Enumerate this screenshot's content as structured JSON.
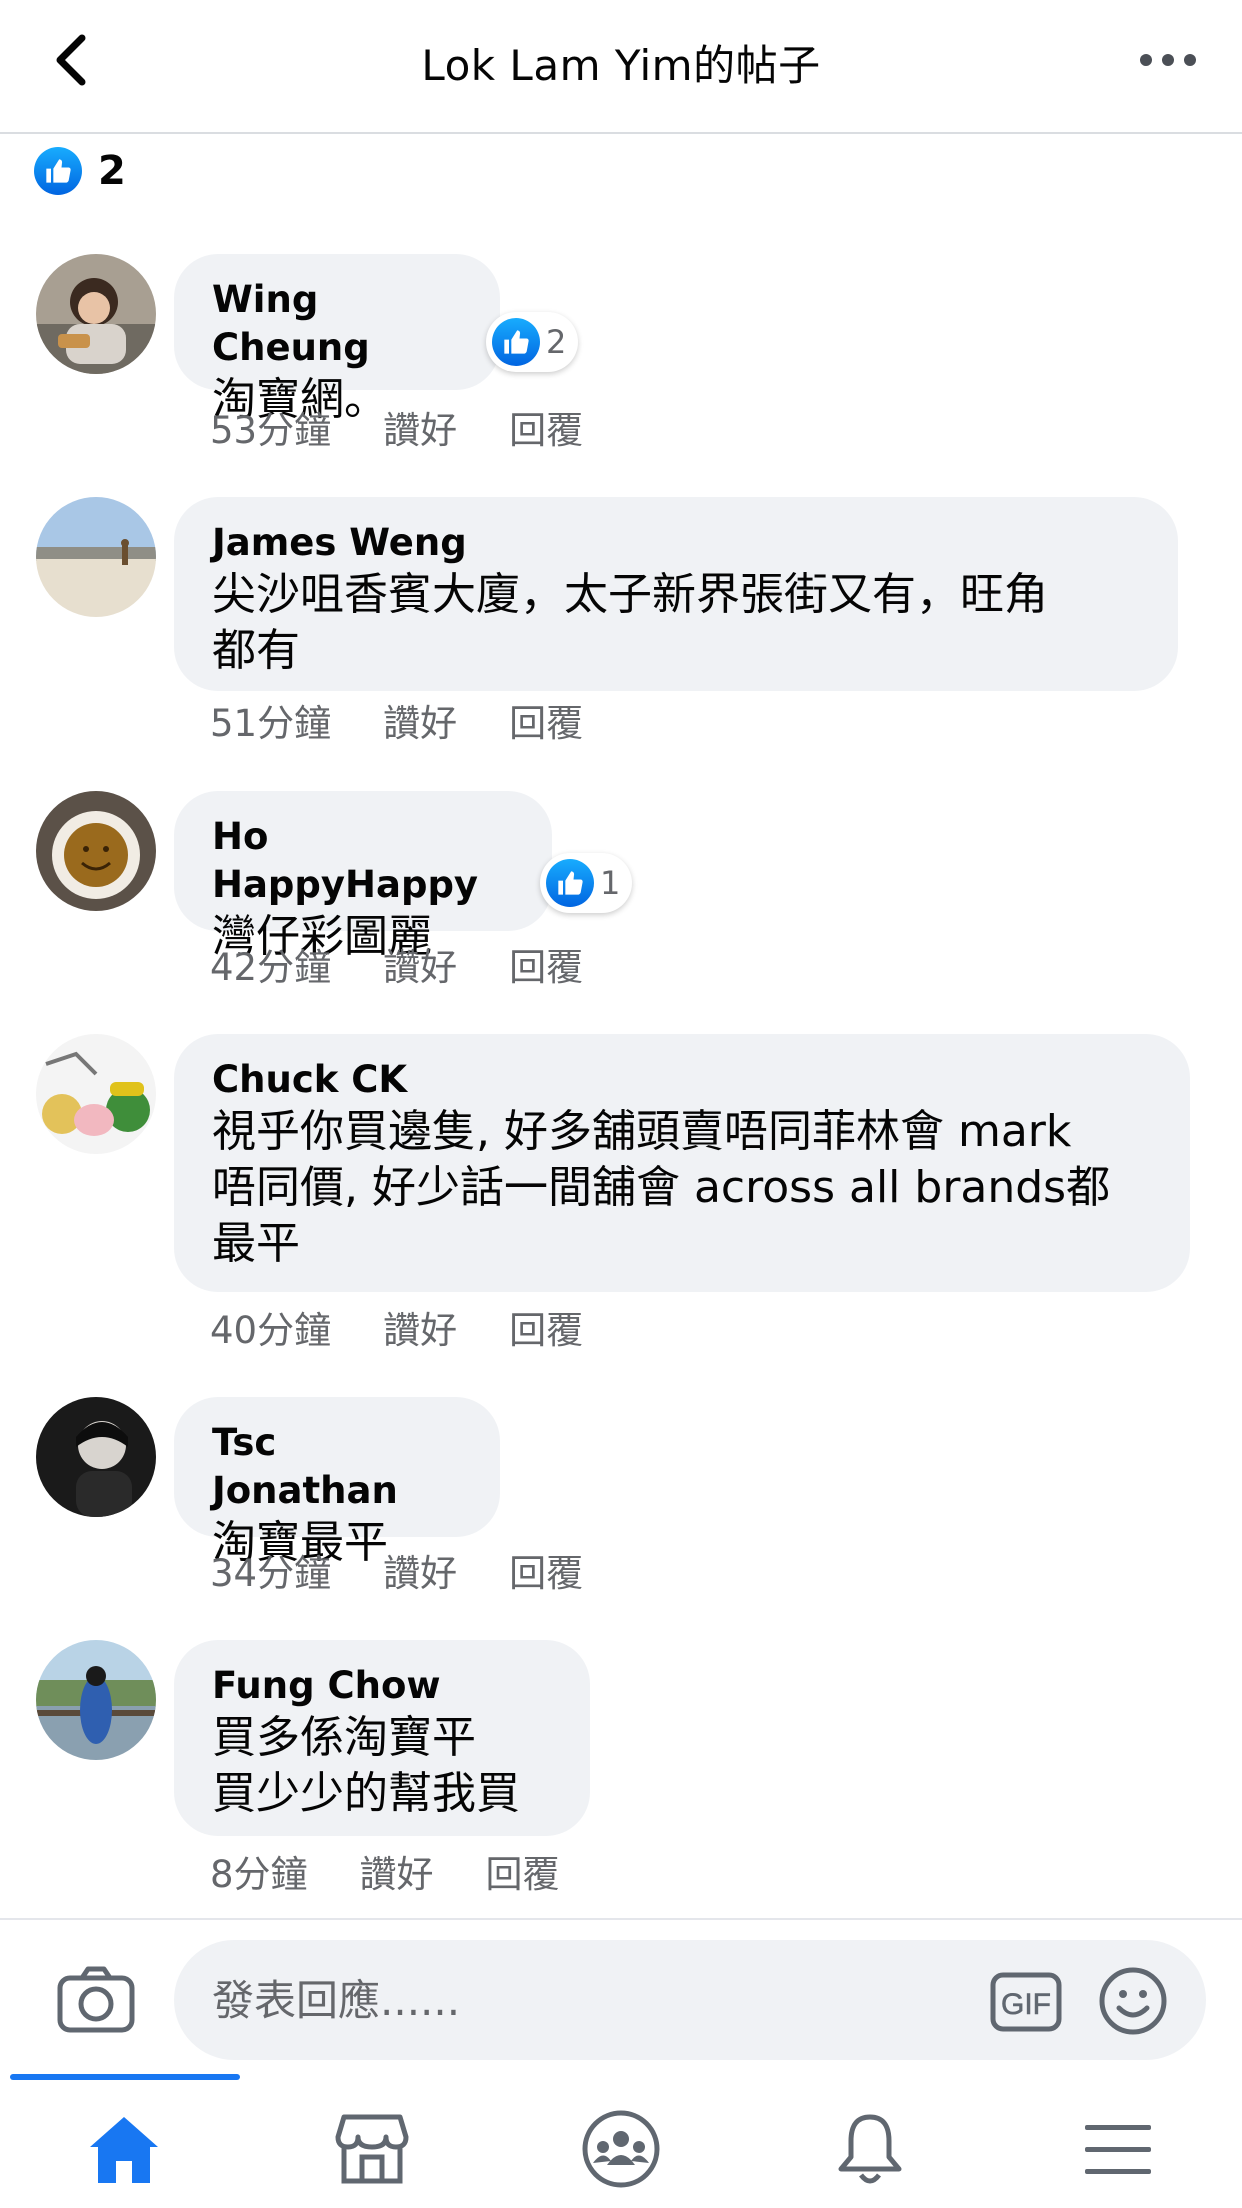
{
  "header": {
    "title": "Lok Lam Yim的帖子"
  },
  "post": {
    "reaction_count": "2"
  },
  "labels": {
    "like": "讚好",
    "reply": "回覆"
  },
  "comments": [
    {
      "author": "Wing Cheung",
      "text": [
        "淘寶網。"
      ],
      "time": "53分鐘",
      "reactions": "2"
    },
    {
      "author": "James Weng",
      "text": [
        "尖沙咀香賓大廈，太子新界張街又有，旺角",
        "都有"
      ],
      "time": "51分鐘",
      "reactions": ""
    },
    {
      "author": "Ho HappyHappy",
      "text": [
        "灣仔彩圖麗"
      ],
      "time": "42分鐘",
      "reactions": "1"
    },
    {
      "author": "Chuck CK",
      "text": [
        "視乎你買邊隻, 好多舖頭賣唔同菲林會 mark",
        "唔同價, 好少話一間舖會 across all brands都",
        "最平"
      ],
      "time": "40分鐘",
      "reactions": ""
    },
    {
      "author": "Tsc Jonathan",
      "text": [
        "淘寶最平"
      ],
      "time": "34分鐘",
      "reactions": ""
    },
    {
      "author": "Fung Chow",
      "text": [
        "買多係淘寶平",
        "買少少的幫我買"
      ],
      "time": "8分鐘",
      "reactions": ""
    }
  ],
  "composer": {
    "placeholder": "發表回應......"
  },
  "tabs": [
    {
      "name": "home-icon",
      "active": true
    },
    {
      "name": "marketplace-icon",
      "active": false
    },
    {
      "name": "groups-icon",
      "active": false
    },
    {
      "name": "notifications-icon",
      "active": false
    },
    {
      "name": "menu-icon",
      "active": false
    }
  ],
  "colors": {
    "accent": "#1877f2",
    "bubble": "#f0f2f5",
    "meta_text": "#65676b"
  }
}
